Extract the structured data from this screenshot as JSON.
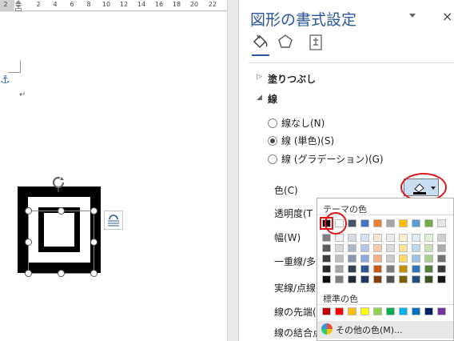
{
  "ruler": {
    "numbers": [
      "2",
      "2",
      "4",
      "6",
      "8",
      "10",
      "12",
      "14",
      "16",
      "18",
      "20",
      "22"
    ]
  },
  "pane": {
    "title": "図形の書式設定",
    "close": "×",
    "category_icons": [
      "fill-line-icon",
      "effects-pentagon-icon",
      "size-layout-icon"
    ],
    "sections": {
      "fill": "塗りつぶし",
      "line": "線"
    },
    "radios": [
      {
        "label": "線なし(N)",
        "checked": false
      },
      {
        "label": "線 (単色)(S)",
        "checked": true
      },
      {
        "label": "線 (グラデーション)(G)",
        "checked": false
      }
    ],
    "props": [
      "色(C)",
      "透明度(T",
      "幅(W)",
      "一重線/多",
      "実線/点線",
      "線の先端(",
      "線の結合点"
    ],
    "accent_color": "#2b579a"
  },
  "popup": {
    "theme_label": "テーマの色",
    "standard_label": "標準の色",
    "more_label": "その他の色(M)...",
    "theme_top": [
      "#000000",
      "#ffffff",
      "#44546a",
      "#4472c4",
      "#ed7d31",
      "#a5a5a5",
      "#ffc000",
      "#5b9bd5",
      "#70ad47",
      "#e7e6e6"
    ],
    "theme_shades": [
      [
        "#7f7f7f",
        "#f2f2f2",
        "#d6dce4",
        "#d9e2f3",
        "#fbe5d5",
        "#ededed",
        "#fff2cc",
        "#deebf6",
        "#e2efd9",
        "#d0cece"
      ],
      [
        "#595959",
        "#d8d8d8",
        "#adb9ca",
        "#b4c6e7",
        "#f7cbac",
        "#dbdbdb",
        "#fee599",
        "#bdd7ee",
        "#c5e0b3",
        "#aeabab"
      ],
      [
        "#3f3f3f",
        "#bfbfbf",
        "#8496b0",
        "#8eaadb",
        "#f4b183",
        "#c9c9c9",
        "#ffd965",
        "#9cc3e5",
        "#a8d08d",
        "#757070"
      ],
      [
        "#262626",
        "#a5a5a5",
        "#323f4f",
        "#2f5496",
        "#c55a11",
        "#7b7b7b",
        "#bf9000",
        "#2e75b5",
        "#538135",
        "#3a3838"
      ],
      [
        "#0c0c0c",
        "#7f7f7f",
        "#222a35",
        "#1f3864",
        "#833c0b",
        "#525252",
        "#7f6000",
        "#1e4e79",
        "#375623",
        "#171616"
      ]
    ],
    "standard": [
      "#c00000",
      "#ff0000",
      "#ffc000",
      "#ffff00",
      "#92d050",
      "#00b050",
      "#00b0f0",
      "#0070c0",
      "#002060",
      "#7030a0"
    ]
  }
}
